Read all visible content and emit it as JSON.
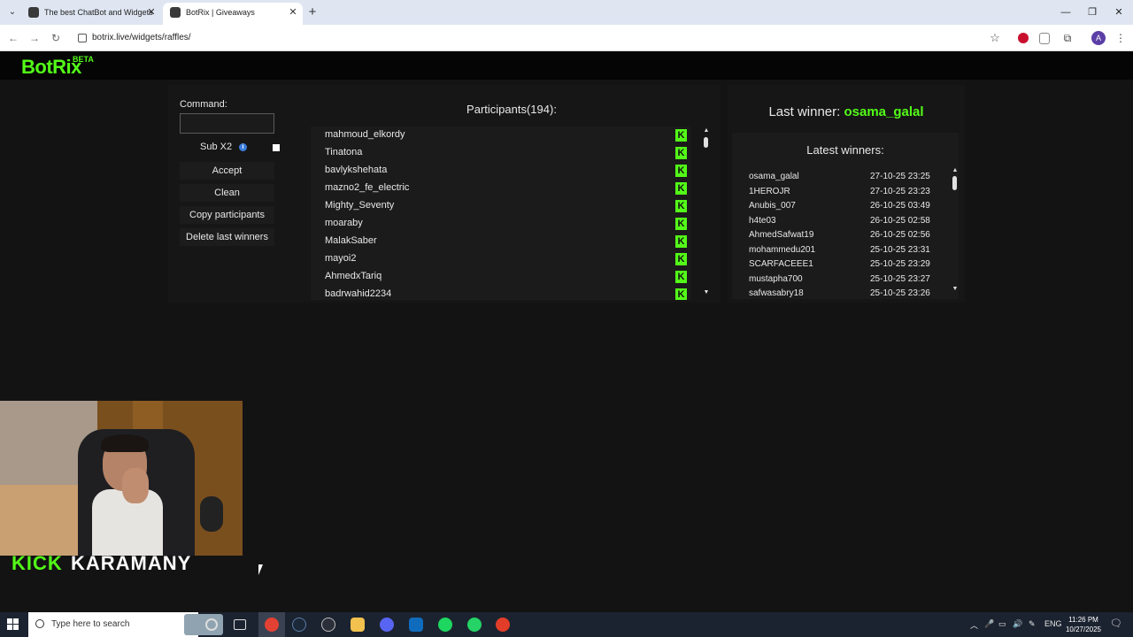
{
  "browser": {
    "tabs": [
      {
        "title": "The best ChatBot and Widgets"
      },
      {
        "title": "BotRix | Giveaways"
      }
    ],
    "url": "botrix.live/widgets/raffles/"
  },
  "site": {
    "logo": "BotRix",
    "logo_badge": "BETA"
  },
  "raffle": {
    "command_label": "Command:",
    "command_value": "",
    "sub_label": "Sub X2",
    "buttons": {
      "accept": "Accept",
      "clean": "Clean",
      "copy": "Copy participants",
      "delete": "Delete last winners"
    },
    "participants_title": "Participants(194):",
    "participants": [
      {
        "name": "mahmoud_elkordy"
      },
      {
        "name": "Tinatona"
      },
      {
        "name": "bavlykshehata"
      },
      {
        "name": "mazno2_fe_electric"
      },
      {
        "name": "Mighty_Seventy"
      },
      {
        "name": "moaraby"
      },
      {
        "name": "MalakSaber"
      },
      {
        "name": "mayoi2"
      },
      {
        "name": "AhmedxTariq"
      },
      {
        "name": "badrwahid2234"
      }
    ],
    "platform_badge": "K"
  },
  "winners": {
    "last_winner_label": "Last winner:",
    "last_winner_name": "osama_galal",
    "latest_title": "Latest winners:",
    "list": [
      {
        "name": "osama_galal",
        "date": "27-10-25 23:25"
      },
      {
        "name": "1HEROJR",
        "date": "27-10-25 23:23"
      },
      {
        "name": "Anubis_007",
        "date": "26-10-25 03:49"
      },
      {
        "name": "h4te03",
        "date": "26-10-25 02:58"
      },
      {
        "name": "AhmedSafwat19",
        "date": "26-10-25 02:56"
      },
      {
        "name": "mohammedu201",
        "date": "25-10-25 23:31"
      },
      {
        "name": "SCARFACEEE1",
        "date": "25-10-25 23:29"
      },
      {
        "name": "mustapha700",
        "date": "25-10-25 23:27"
      },
      {
        "name": "safwasabry18",
        "date": "25-10-25 23:26"
      }
    ]
  },
  "overlay": {
    "brand_kick": "KICK",
    "brand_name": "KARAMANY"
  },
  "taskbar": {
    "search_placeholder": "Type here to search",
    "language": "ENG",
    "time": "11:26 PM",
    "date": "10/27/2025"
  },
  "colors": {
    "accent": "#53fc18",
    "background": "#131313",
    "panel": "#161616"
  }
}
